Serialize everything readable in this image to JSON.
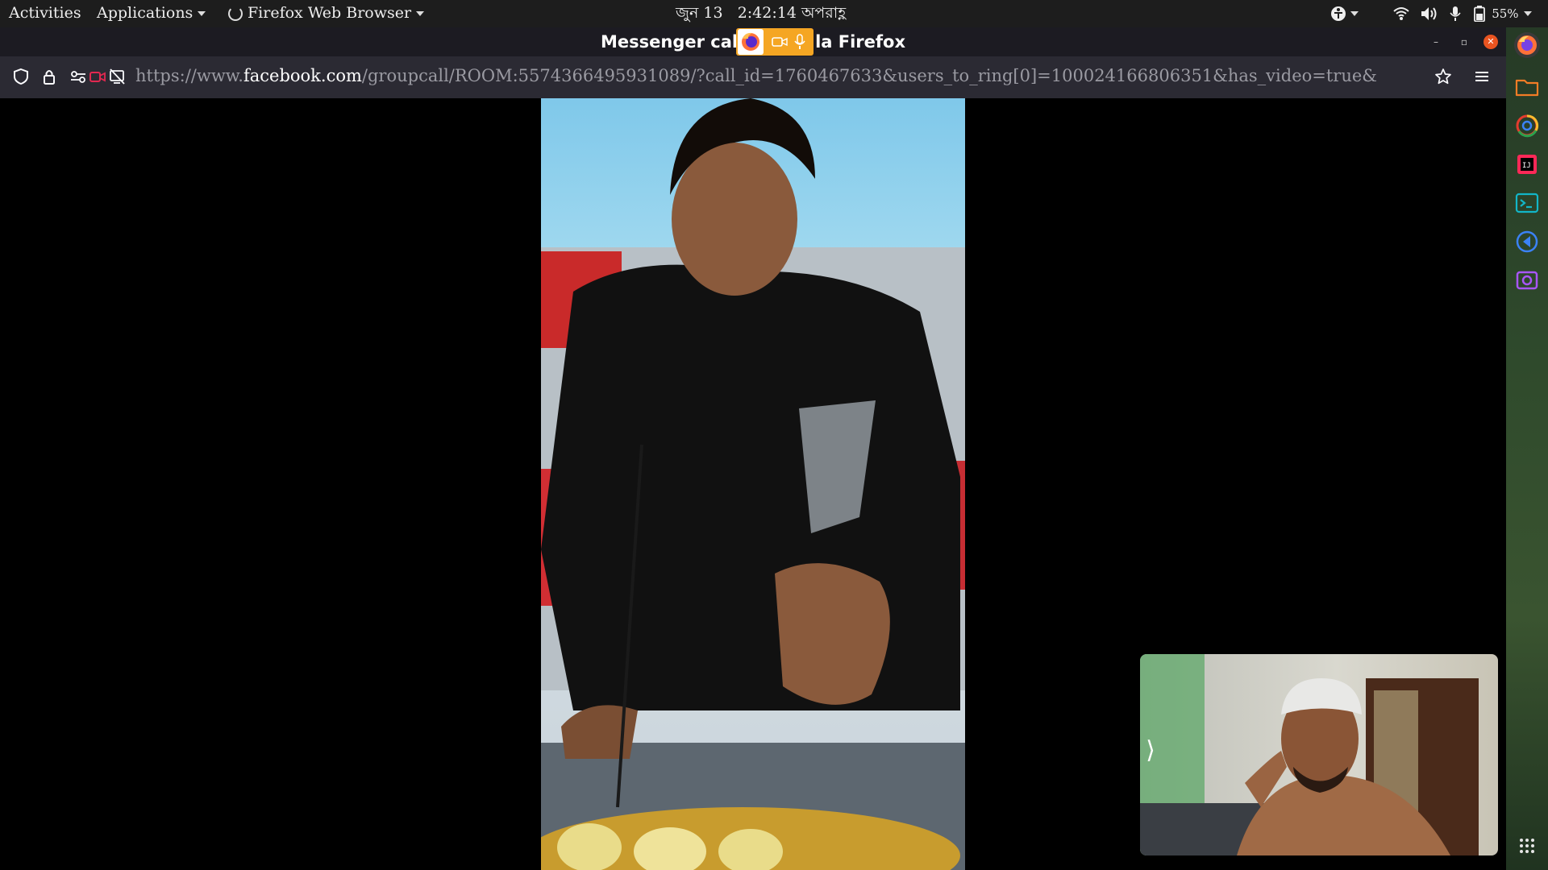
{
  "topbar": {
    "activities": "Activities",
    "applications": "Applications",
    "app_name": "Firefox Web Browser",
    "date": "জুন 13",
    "time": "2:42:14 অপরাহ্ণ",
    "battery": "55%"
  },
  "window": {
    "title_left": "Messenger cal",
    "title_right": "la Firefox"
  },
  "navbar": {
    "url_prefix": "https://www.",
    "url_domain": "facebook.com",
    "url_path": "/groupcall/ROOM:5574366495931089/?call_id=1760467633&users_to_ring[0]=100024166806351&has_video=true&"
  },
  "call": {
    "self_view_arrow": "⟩"
  },
  "colors": {
    "accent_sharing": "#f5a623",
    "close_button": "#e95420"
  }
}
